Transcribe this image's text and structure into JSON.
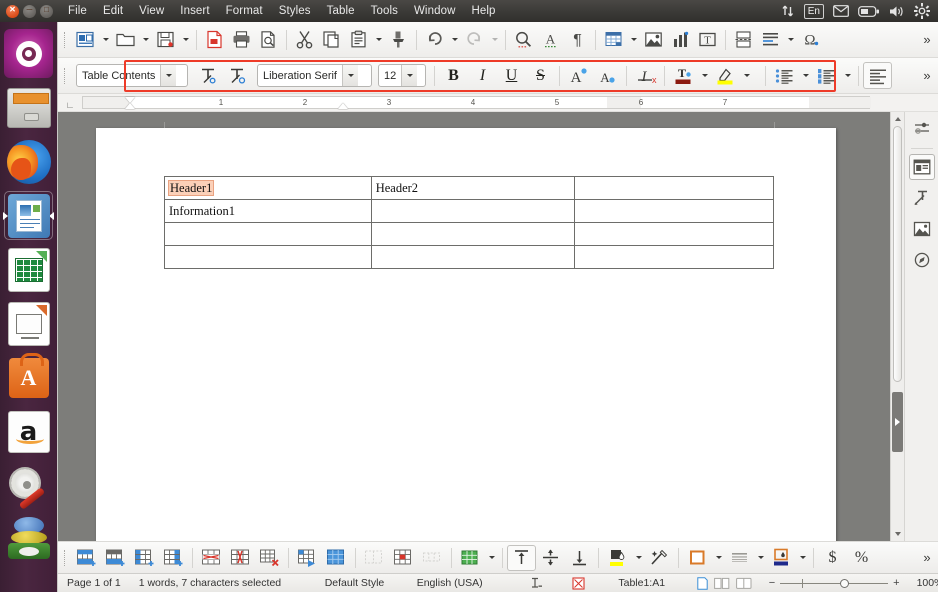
{
  "window": {
    "titlebar_buttons": [
      "close",
      "minimize",
      "maximize"
    ],
    "menus": [
      "File",
      "Edit",
      "View",
      "Insert",
      "Format",
      "Styles",
      "Table",
      "Tools",
      "Window",
      "Help"
    ],
    "tray": {
      "sync_icon": "sync-arrows-icon",
      "language": "En",
      "mail_icon": "mail-icon",
      "battery_icon": "battery-icon",
      "volume_icon": "volume-icon",
      "settings_icon": "gear-icon"
    }
  },
  "launcher": {
    "items": [
      {
        "name": "ubuntu-dash",
        "label": "Ubuntu Dash"
      },
      {
        "name": "files",
        "label": "Files"
      },
      {
        "name": "firefox",
        "label": "Firefox Web Browser"
      },
      {
        "name": "libreoffice-writer",
        "label": "LibreOffice Writer",
        "selected": true
      },
      {
        "name": "libreoffice-calc",
        "label": "LibreOffice Calc"
      },
      {
        "name": "libreoffice-impress",
        "label": "LibreOffice Impress"
      },
      {
        "name": "ubuntu-software",
        "label": "Ubuntu Software"
      },
      {
        "name": "amazon",
        "label": "Amazon"
      },
      {
        "name": "system-settings",
        "label": "System Settings"
      },
      {
        "name": "gimp",
        "label": "GIMP"
      }
    ]
  },
  "standard_toolbar": {
    "items": [
      {
        "name": "new-document",
        "label": "New",
        "dropdown": true
      },
      {
        "name": "open-document",
        "label": "Open",
        "dropdown": true
      },
      {
        "name": "save-document",
        "label": "Save",
        "dropdown": true
      },
      {
        "name": "export-pdf",
        "label": "Export as PDF"
      },
      {
        "name": "print",
        "label": "Print"
      },
      {
        "name": "print-preview",
        "label": "Toggle Print Preview"
      },
      {
        "name": "cut",
        "label": "Cut"
      },
      {
        "name": "copy",
        "label": "Copy"
      },
      {
        "name": "paste",
        "label": "Paste",
        "dropdown": true
      },
      {
        "name": "clone-formatting",
        "label": "Clone Formatting"
      },
      {
        "name": "undo",
        "label": "Undo",
        "dropdown": true
      },
      {
        "name": "redo",
        "label": "Redo",
        "dropdown": true,
        "disabled": true
      },
      {
        "name": "find-and-replace",
        "label": "Find and Replace"
      },
      {
        "name": "spelling",
        "label": "Check Spelling"
      },
      {
        "name": "formatting-marks",
        "label": "Formatting Marks"
      },
      {
        "name": "insert-table",
        "label": "Insert Table",
        "dropdown": true
      },
      {
        "name": "insert-image",
        "label": "Insert Image"
      },
      {
        "name": "insert-chart",
        "label": "Insert Chart"
      },
      {
        "name": "insert-text-box",
        "label": "Insert Text Box"
      },
      {
        "name": "insert-page-break",
        "label": "Insert Page Break"
      },
      {
        "name": "insert-field",
        "label": "Insert Field",
        "dropdown": true
      },
      {
        "name": "insert-special-character",
        "label": "Insert Special Character"
      }
    ],
    "overflow_label": "»"
  },
  "formatting_toolbar": {
    "paragraph_style": {
      "value": "Table Contents",
      "placeholder": "Paragraph Style"
    },
    "font_name": {
      "value": "Liberation Serif",
      "placeholder": "Font Name"
    },
    "font_size": {
      "value": "12",
      "placeholder": "Font Size"
    },
    "buttons": [
      {
        "name": "update-style",
        "label": "Update Selected Style"
      },
      {
        "name": "new-style",
        "label": "New Style from Selection"
      },
      {
        "name": "bold",
        "label": "B"
      },
      {
        "name": "italic",
        "label": "I"
      },
      {
        "name": "underline",
        "label": "U"
      },
      {
        "name": "strikethrough",
        "label": "S"
      },
      {
        "name": "increase-font-size",
        "label": "Increase Size"
      },
      {
        "name": "decrease-font-size",
        "label": "Decrease Size"
      },
      {
        "name": "clear-formatting",
        "label": "Clear Direct Formatting"
      },
      {
        "name": "font-color",
        "label": "Font Color",
        "color": "#8b1a10",
        "dropdown": true
      },
      {
        "name": "highlighting-color",
        "label": "Highlighting Color",
        "color": "#ffff00",
        "dropdown": true
      },
      {
        "name": "unordered-list",
        "label": "Unordered List",
        "dropdown": true
      },
      {
        "name": "ordered-list",
        "label": "Ordered List",
        "dropdown": true
      },
      {
        "name": "align-left",
        "label": "Align Left",
        "active": true
      }
    ],
    "overflow_label": "»",
    "highlight_box_color": "#ee3b28"
  },
  "ruler": {
    "corner_icon": "tab-stop-icon",
    "labels": [
      "1",
      "2",
      "3",
      "4",
      "5",
      "6",
      "7"
    ],
    "unit": "inch"
  },
  "document": {
    "table_name": "Table1",
    "rows": [
      {
        "cells": [
          "Header1",
          "Header2",
          ""
        ],
        "selected_cell": 0
      },
      {
        "cells": [
          "Information1",
          "",
          ""
        ]
      },
      {
        "cells": [
          "",
          "",
          ""
        ]
      },
      {
        "cells": [
          "",
          "",
          ""
        ]
      }
    ],
    "selection_color": "#fbd0b8"
  },
  "sidebar_deck": {
    "items": [
      {
        "name": "sidebar-settings",
        "label": "Sidebar Settings"
      },
      {
        "name": "properties",
        "label": "Properties",
        "current": true
      },
      {
        "name": "styles",
        "label": "Styles"
      },
      {
        "name": "gallery",
        "label": "Gallery"
      },
      {
        "name": "navigator",
        "label": "Navigator"
      }
    ]
  },
  "table_toolbar": {
    "items": [
      {
        "name": "insert-row-above",
        "label": "Rows Above"
      },
      {
        "name": "insert-row-below",
        "label": "Rows Below"
      },
      {
        "name": "insert-column-before",
        "label": "Columns Before"
      },
      {
        "name": "insert-column-after",
        "label": "Columns After"
      },
      {
        "name": "delete-row",
        "label": "Delete Row"
      },
      {
        "name": "delete-column",
        "label": "Delete Column"
      },
      {
        "name": "delete-table",
        "label": "Delete Table"
      },
      {
        "name": "select-cell",
        "label": "Select Cell"
      },
      {
        "name": "select-table",
        "label": "Select Table"
      },
      {
        "name": "merge-cells",
        "label": "Merge Cells",
        "disabled": true
      },
      {
        "name": "split-cells",
        "label": "Split Cells"
      },
      {
        "name": "optimize-size",
        "label": "Optimize Size",
        "disabled": true
      },
      {
        "name": "table-properties",
        "label": "Table Properties",
        "dropdown": true
      },
      {
        "name": "align-top",
        "label": "Align Top",
        "active": true
      },
      {
        "name": "center-vertically",
        "label": "Center Vertically"
      },
      {
        "name": "align-bottom",
        "label": "Align Bottom"
      },
      {
        "name": "table-cell-background-color",
        "label": "Background Color",
        "color": "#ffff00",
        "dropdown": true
      },
      {
        "name": "autoformat-styles",
        "label": "AutoFormat Styles"
      },
      {
        "name": "borders",
        "label": "Borders",
        "color": "#d97a29",
        "dropdown": true
      },
      {
        "name": "border-style",
        "label": "Border Style",
        "dropdown": true
      },
      {
        "name": "border-color",
        "label": "Border Color",
        "color": "#1f2a8b",
        "dropdown": true
      },
      {
        "name": "currency-format",
        "label": "$"
      },
      {
        "name": "percent-format",
        "label": "%"
      }
    ],
    "overflow_label": "»"
  },
  "status_bar": {
    "page": "Page 1 of 1",
    "word_count": "1 words, 7 characters selected",
    "page_style": "Default Style",
    "language": "English (USA)",
    "insert_mode_icon": "text-cursor-icon",
    "selection_mode_icon": "selection-mode-icon",
    "table_cell": "Table1:A1",
    "view_layout": [
      "single-page-view",
      "multi-page-view",
      "book-view"
    ],
    "zoom_out": "−",
    "zoom_in": "+",
    "zoom_level": "100%"
  }
}
